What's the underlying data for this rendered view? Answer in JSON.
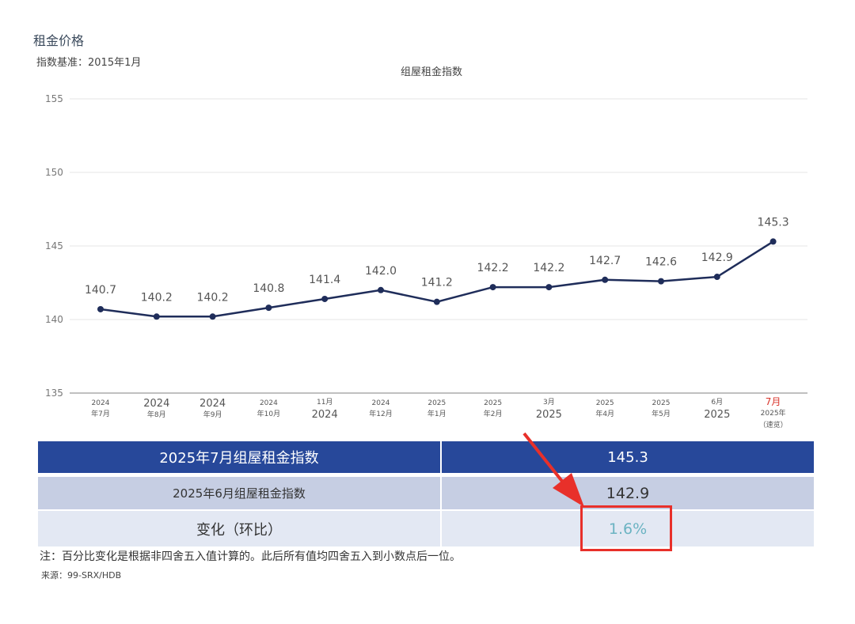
{
  "section_title": "租金价格",
  "index_base": "指数基准：2015年1月",
  "chart_data": {
    "type": "line",
    "title": "组屋租金指数",
    "ylim": [
      135,
      155
    ],
    "yticks": [
      135,
      140,
      145,
      150,
      155
    ],
    "grid": true,
    "series": [
      {
        "values": [
          140.7,
          140.2,
          140.2,
          140.8,
          141.4,
          142.0,
          141.2,
          142.2,
          142.2,
          142.7,
          142.6,
          142.9,
          145.3
        ],
        "labels": [
          "140.7",
          "140.2",
          "140.2",
          "140.8",
          "141.4",
          "142.0",
          "141.2",
          "142.2",
          "142.2",
          "142.7",
          "142.6",
          "142.9",
          "145.3"
        ],
        "color": "#1f2d5a"
      }
    ],
    "categories": [
      {
        "lines": [
          "2024",
          "年7月"
        ],
        "style": "small"
      },
      {
        "lines": [
          "2024",
          "年8月"
        ],
        "style": "mixed"
      },
      {
        "lines": [
          "2024",
          "年9月"
        ],
        "style": "mixed"
      },
      {
        "lines": [
          "2024",
          "年10月"
        ],
        "style": "small"
      },
      {
        "lines": [
          "11月",
          "2024"
        ],
        "style": "mixed2"
      },
      {
        "lines": [
          "2024",
          "年12月"
        ],
        "style": "small"
      },
      {
        "lines": [
          "2025",
          "年1月"
        ],
        "style": "small"
      },
      {
        "lines": [
          "2025",
          "年2月"
        ],
        "style": "small"
      },
      {
        "lines": [
          "3月",
          "2025"
        ],
        "style": "mixed2"
      },
      {
        "lines": [
          "2025",
          "年4月"
        ],
        "style": "small"
      },
      {
        "lines": [
          "2025",
          "年5月"
        ],
        "style": "small"
      },
      {
        "lines": [
          "6月",
          "2025"
        ],
        "style": "mixed2"
      },
      {
        "lines": [
          "7月",
          "2025年",
          "（速览）"
        ],
        "style": "red"
      }
    ]
  },
  "table": {
    "rows": [
      {
        "label": "2025年7月组屋租金指数",
        "value": "145.3"
      },
      {
        "label": "2025年6月组屋租金指数",
        "value": "142.9"
      },
      {
        "label": "变化（环比）",
        "value": "1.6%"
      }
    ]
  },
  "note": "注：百分比变化是根据非四舍五入值计算的。此后所有值均四舍五入到小数点后一位。",
  "source": "来源：99-SRX/HDB",
  "colors": {
    "line": "#1f2d5a",
    "header": "#27489a",
    "highlight": "#e8302a"
  }
}
